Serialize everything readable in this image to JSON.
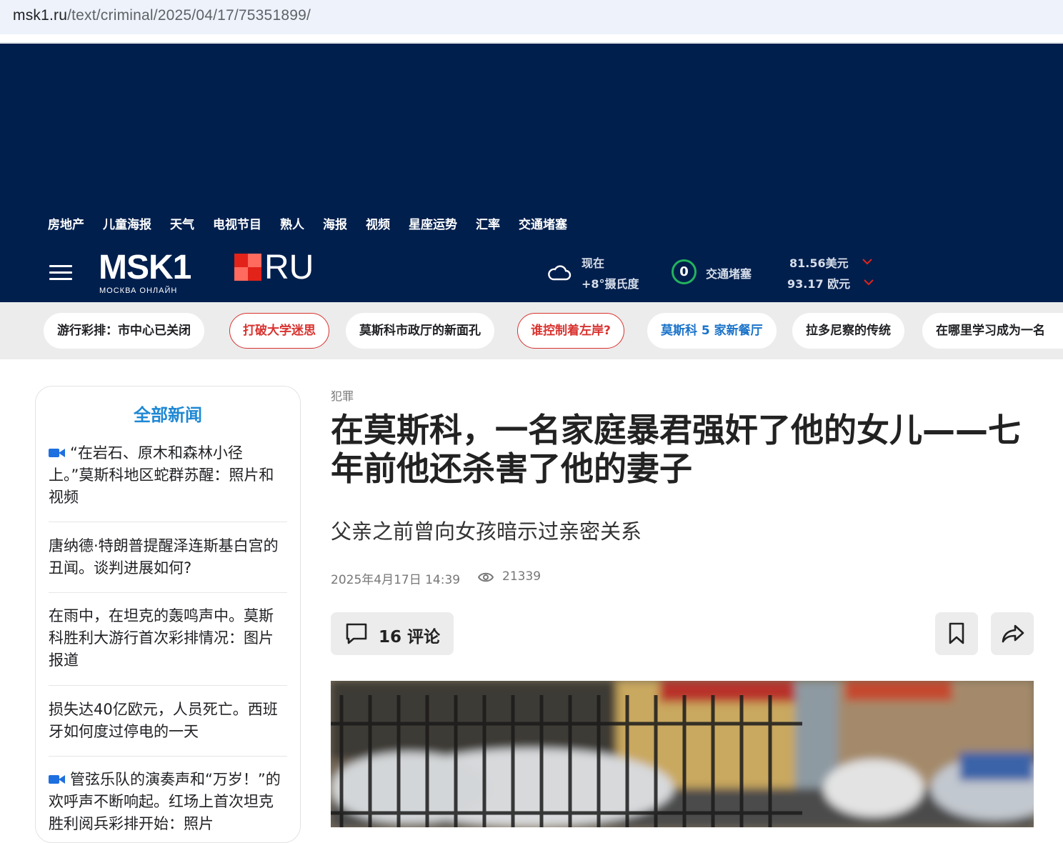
{
  "browser": {
    "url_host": "msk1.ru",
    "url_path": "/text/criminal/2025/04/17/75351899/"
  },
  "topnav": [
    "房地产",
    "儿童海报",
    "天气",
    "电视节目",
    "熟人",
    "海报",
    "视频",
    "星座运势",
    "汇率",
    "交通堵塞"
  ],
  "logo": {
    "main": "MSK1",
    "suffix": "RU",
    "tagline": "МОСКВА ОНЛАЙН"
  },
  "weather": {
    "label": "现在",
    "temp": "+8°摄氏度",
    "icon": "cloud-icon"
  },
  "traffic": {
    "score": "0",
    "label": "交通堵塞",
    "color": "#23b35d"
  },
  "rates": {
    "usd": "81.56美元",
    "eur": "93.17 欧元"
  },
  "pills": [
    {
      "label": "游行彩排：市中心已关闭",
      "style": "plain"
    },
    {
      "label": "打破大学迷思",
      "style": "red"
    },
    {
      "label": "莫斯科市政厅的新面孔",
      "style": "plain"
    },
    {
      "label": "谁控制着左岸?",
      "style": "red"
    },
    {
      "label": "莫斯科 5 家新餐厅",
      "style": "blue"
    },
    {
      "label": "拉多尼察的传统",
      "style": "plain"
    },
    {
      "label": "在哪里学习成为一名",
      "style": "plain"
    }
  ],
  "sidebar": {
    "title": "全部新闻",
    "items": [
      {
        "text": "“在岩石、原木和森林小径上。”莫斯科地区蛇群苏醒：照片和视频",
        "video": true
      },
      {
        "text": "唐纳德·特朗普提醒泽连斯基白宫的丑闻。谈判进展如何?",
        "video": false
      },
      {
        "text": "在雨中，在坦克的轰鸣声中。莫斯科胜利大游行首次彩排情况：图片报道",
        "video": false
      },
      {
        "text": "损失达40亿欧元，人员死亡。西班牙如何度过停电的一天",
        "video": false
      },
      {
        "text": "管弦乐队的演奏声和“万岁！”的欢呼声不断响起。红场上首次坦克胜利阅兵彩排开始：照片",
        "video": true
      }
    ]
  },
  "article": {
    "category": "犯罪",
    "headline": "在莫斯科，一名家庭暴君强奸了他的女儿——七年前他还杀害了他的妻子",
    "subhead": "父亲之前曾向女孩暗示过亲密关系",
    "date": "2025年4月17日 14:39",
    "views": "21339",
    "comments": "16 评论"
  },
  "colors": {
    "header_bg": "#001f4d",
    "accent_blue": "#1e88d4",
    "accent_red": "#d9332f"
  }
}
